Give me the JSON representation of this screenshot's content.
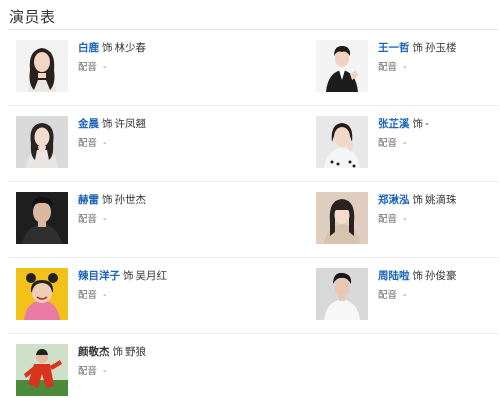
{
  "section": {
    "title": "演员表"
  },
  "separator": "饰",
  "dub_label": "配音",
  "cast": [
    {
      "actor": "白鹿",
      "role": "林少春",
      "dub": "-",
      "linked": true,
      "avatar_icon": "woman-long-hair-photo",
      "bg": "#f3f3f3"
    },
    {
      "actor": "王一哲",
      "role": "孙玉楼",
      "dub": "-",
      "linked": true,
      "avatar_icon": "man-dark-suit-photo",
      "bg": "#f4f4f4"
    },
    {
      "actor": "金晨",
      "role": "许凤翘",
      "dub": "-",
      "linked": true,
      "avatar_icon": "woman-dark-hair-photo",
      "bg": "#dadada"
    },
    {
      "actor": "张芷溪",
      "role": "-",
      "dub": "-",
      "linked": true,
      "avatar_icon": "woman-hand-on-face-photo",
      "bg": "#e8e8e8"
    },
    {
      "actor": "赫雷",
      "role": "孙世杰",
      "dub": "-",
      "linked": true,
      "avatar_icon": "man-dark-jacket-photo",
      "bg": "#1e1e1e"
    },
    {
      "actor": "郑湫泓",
      "role": "姚滴珠",
      "dub": "-",
      "linked": true,
      "avatar_icon": "woman-bangs-photo",
      "bg": "#e0cfc0"
    },
    {
      "actor": "辣目洋子",
      "role": "吴月红",
      "dub": "-",
      "linked": true,
      "avatar_icon": "woman-hair-buns-photo",
      "bg": "#f2c21b"
    },
    {
      "actor": "周陆啦",
      "role": "孙俊豪",
      "dub": "-",
      "linked": true,
      "avatar_icon": "man-white-shirt-photo",
      "bg": "#d9d9d9"
    },
    {
      "actor": "颜敬杰",
      "role": "野狼",
      "dub": "-",
      "linked": false,
      "avatar_icon": "man-red-outfit-photo",
      "bg": "#cfe0c8"
    }
  ]
}
